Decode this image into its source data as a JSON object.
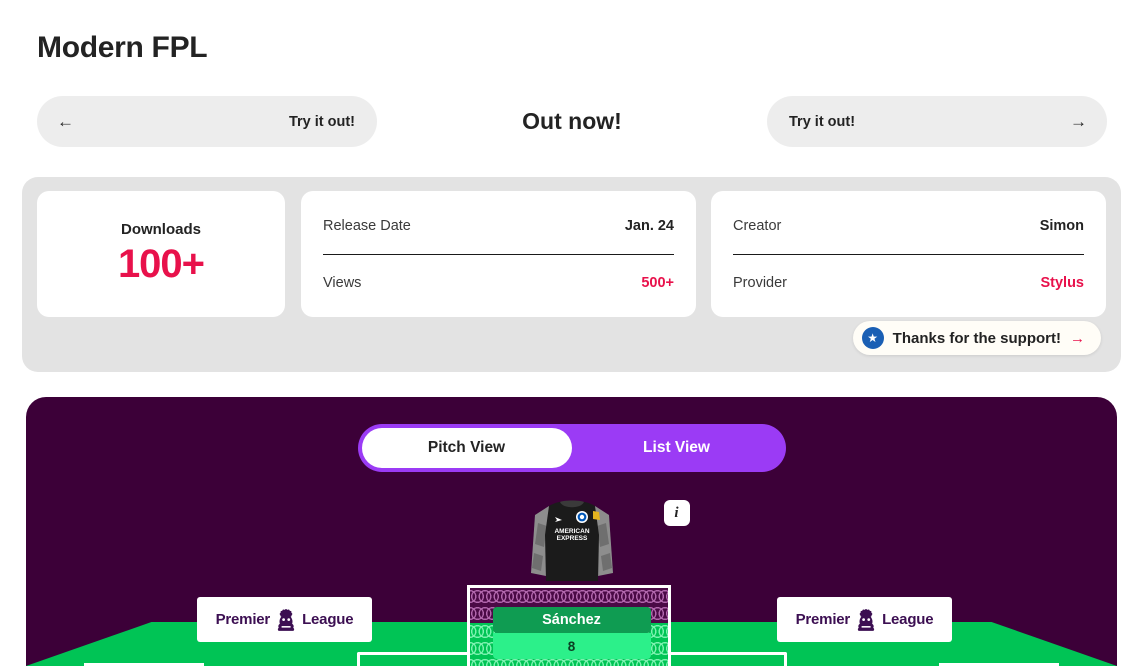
{
  "header": {
    "title": "Modern FPL"
  },
  "nav": {
    "prev": {
      "label": "Try it out!",
      "icon": "arrow-left-icon",
      "glyph": "←"
    },
    "center_label": "Out now!",
    "next": {
      "label": "Try it out!",
      "icon": "arrow-right-icon",
      "glyph": "→"
    }
  },
  "stats": {
    "downloads": {
      "label": "Downloads",
      "value": "100+"
    },
    "middle_rows": [
      {
        "key": "Release Date",
        "value": "Jan. 24",
        "accent": false
      },
      {
        "key": "Views",
        "value": "500+",
        "accent": true
      }
    ],
    "right_rows": [
      {
        "key": "Creator",
        "value": "Simon",
        "accent": false
      },
      {
        "key": "Provider",
        "value": "Stylus",
        "accent": true
      }
    ],
    "thanks": {
      "label": "Thanks for the support!",
      "star_icon": "star-icon",
      "star_glyph": "★",
      "arrow_icon": "arrow-right-icon",
      "arrow_glyph": "→"
    }
  },
  "app": {
    "view_toggle": {
      "options": [
        {
          "label": "Pitch View",
          "active": true
        },
        {
          "label": "List View",
          "active": false
        }
      ]
    },
    "info_button": {
      "icon": "info-icon",
      "glyph": "i"
    },
    "player": {
      "name": "Sánchez",
      "points": "8",
      "kit": "goalkeeper-kit-brighton",
      "kit_sponsor": "AMERICAN EXPRESS"
    },
    "pl_badges": [
      {
        "word1": "Premier",
        "word2": "League",
        "icon": "premier-league-lion-icon"
      },
      {
        "word1": "Premier",
        "word2": "League",
        "icon": "premier-league-lion-icon"
      }
    ]
  },
  "colors": {
    "accent_pink": "#e8114b",
    "panel_purple": "#3c0038",
    "toggle_purple": "#9b3bf5",
    "pitch_green": "#00c455",
    "badge_blue": "#1a5fb4",
    "stats_panel_gray": "#e3e3e3",
    "nav_button_gray": "#ededed"
  }
}
